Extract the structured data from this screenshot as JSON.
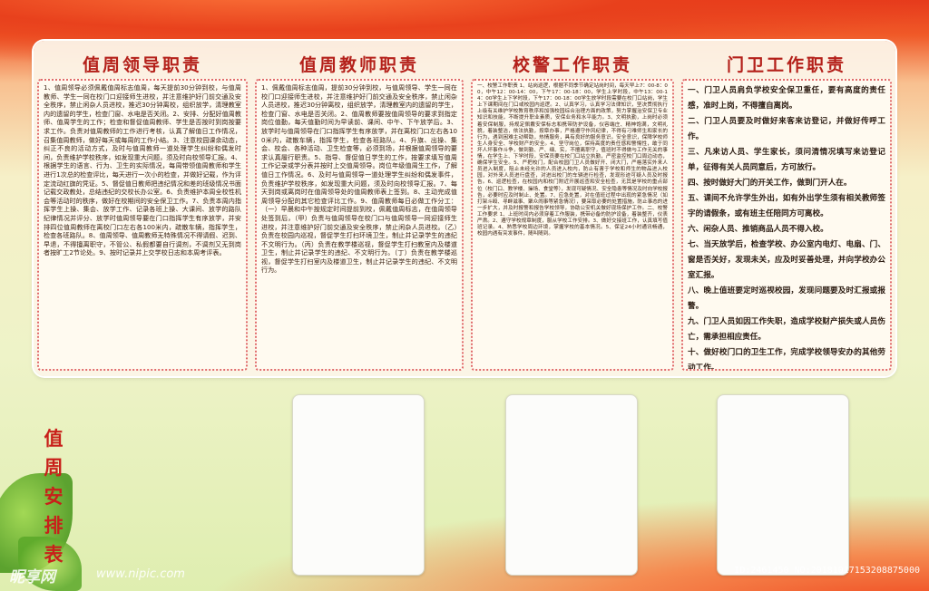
{
  "columns": [
    {
      "title": "值周领导职责",
      "text": "1、值周领导必须佩戴值周标志值周，每天提前30分钟到校，与值周教师、学生一同在校门口迎接师生进校，并注意维护好门前交通及安全秩序，禁止闲杂人员进校，推迟30分钟离校，组织放学，清理教室内的遗留的学生，检查门窗、水电是否关闭。2、安排、分配好值周教师、值周学生的工作；检查和督促值周教师、学生是否按时到岗按要求工作。负责对值周教师的工作进行考核，认真了解值日工作情况，召集值周教师，做好每天或每周的工作小结。3、注意校园课余动态，纠正不良的活动方式，及时与值周教师一道处理学生纠纷和偶发时间，负责维护学校秩序，如发现重大问题，须及时向校领导汇报。4、根据学生的语言、行为、卫生的实际情况，每周带领值周教师和学生进行1次总的检查评比，每天进行一次小的检查，并做好记载，作为评定流动红旗的凭证。5、督促值日教师把违纪情况和差的班级情况书面记载交政教处，总结违纪的交校长办公室。6、负责维护本周全校性机会等活动时的秩序，做好在校期间的安全保卫工作。7、负责本周内指挥学生上操、集会、放学工作、记录各班上操、大课间、放学的路队纪律情况并评分、放学时值周领导要在门口指挥学生有序放学，并安排四位值周教师在离校门口左右各100米内，疏散车辆，指挥学生，检查各班路队。8、值周领导、值周教师无特殊情况不得请假、迟到、早退，不得擅离职守，不管公、私假都要自行调剂，不调剂又无到岗者按旷工2节论处。9、按时记录并上交学校日志和本周考评表。"
    },
    {
      "title": "值周教师职责",
      "text": "1、佩戴值周标志值周，提前30分钟到校，与值周领导、学生一同在校门口迎接师生进校，并注意维护好门前交通及安全秩序，禁止闲杂人员进校，推迟30分钟离校，组织放学，清理教室内的遗留的学生，检查门窗、水电是否关闭。2、值周教师要按值周领导的要求到指定岗位值勤，每天值勤时间为早读前、课间、中午、下午放学后。3、放学时与值周领导在门口指挥学生有序放学，并在离校门口左右各100米内，疏散车辆，指挥学生，检查各班路队。4、升旗、出操、集会、校会、各种活动、卫生检查等，必须到场，并根据值周领导的要求认真履行职责。5、指导、督促值日学生的工作，按要求填写值周工作记录或学分表并按时上交值周领导。岗位年级值周生工作，了解值日工作情况。6、及时与值周领导一道处理学生纠纷和偶发事件，负责维护学校秩序，如发现重大问题，须及时向校领导汇报。7、每天到岗或离岗时在值周领导处的值周教师表上签到。8、主动完成值周领导分配的其它检查评比工作。9、值周教师每日必做工作分工：（一）早晨和中午按规定时间提前到校，佩戴值周标志，在值周领导处签到后，（甲）负责与值周领导在校门口与值周领导一同迎接师生进校，并注意维护好门前交通及安全秩序，禁止闲杂人员进校。（乙）负责在校园内巡视，督促学生打扫环境卫生，制止并记录学生的违纪不文明行为。（丙）负责在教学楼巡视，督促学生打扫教室内及楼道卫生，制止并记录学生的违纪、不文明行为。（丁）负责在教学楼巡视，督促学生打扫室内及楼道卫生，制止并记录学生的违纪、不文明行为。"
    },
    {
      "title": "校警工作职责",
      "text": "一、校警工作职责 1、站岗巡逻，根据不同季节确定站岗时间，每天早上7：00-8：00，中午12：00-14：00，下午17：00-18：00，学生上学时段，中午13：00-14：00学生上下学时段，下午17：00-18：00学生放学时段需要在校门口站岗，学生上下课期间在门口或校园内巡逻。2、认真学习，认真学习法律知识，坚决贯彻执行上级有关维护学校教育秩序和加强校园综合治理方面的政策，努力掌握治安保卫专业知识和技能，不断提升职业素质，安保业务和水平能力。3、文明执勤，上岗时必须着安保制服，持规定佩戴安保标志和携带防护设备，仪容端庄、精神饱满，文明礼貌，着装整洁，依法执勤，按章办事，严格遵守作风纪律，不得有刁难师生和家长的行为，遇到困难主动帮助，热情服务，具有良好的服务意识。安全意识，保障学校师生人身安全、学校财产的安全。4、坚守岗位，保持高度的责任感和警惕性，敢于同坏人坏事作斗争，做到勤、严、细、实，不擅离职守，值班时不得做与工作无关的事情，在学生上、下学时段，安保员要在校门口站立执勤，严密监控校门口周边动态，确保学生安全。5、严把校门，配合校园门卫人员做好开、闭大门，严格落实外来人员进入制度，阻止未经允许的人员进入校内，防止有害于学校和师生的物品进入校园，对外来人员进行盘查，对进出校门的车辆进行检查，发现形迹可疑人员及时报告。6、巡逻检查，在校园内和校门附近开展巡查和安全检查，无其是学校的重点部位（校门口、教学楼、操场、食堂等），发现可疑情况、安全隐患等情况及时向学校报告，必要时应及时制止、处置。7、应急处置，对在值班过程中出现的紧急情况（如打架斗殴、寻衅滋事、聚众闹事等紧急情况），要采取必要的处置措施，防止事态的进一步扩大，并及时报警和报告学校领导，协助公安机关做好现场保护工作。二、校警工作要求 1、上班时间内必须穿着工作服装，携带必备的防护设备，着装整齐，仪表严肃。2、遵守学校规章制度，服从学校工作安排。3、做好交接班工作，认真填写值班记录。4、熟悉学校周边环境，掌握学校的基本情况。5、保证24小时通讯畅通，校园内遇有突发事件，随叫随到。"
    },
    {
      "title": "门卫工作职责",
      "lines": [
        "一、门卫人员肩负学校安全保卫重任，要有高度的责任感，准时上岗，不得擅自离岗。",
        "二、门卫人员要及时做好来客来访登记，并做好传呼工作。",
        "三、凡来访人员、学生家长，须问清情况填写来访登记单，征得有关人员同意后，方可放行。",
        "四、按时做好大门的开关工作，做到门开人在。",
        "五、课间不允许学生外出，如有外出学生须有相关教师签字的请假条，或有班主任陪同方可离校。",
        "六、闲杂人员、推销商品人员不得入校。",
        "七、当天放学后，检查学校、办公室内电灯、电扇、门、窗是否关好，发现未关，应及时妥善处理，并向学校办公室汇报。",
        "八、晚上值班要定时巡视校园，发现问题要及时汇报或报警。",
        "九、门卫人员如因工作失职，造成学校财产损失或人员伤亡，需承担相应责任。",
        "十、做好校门口的卫生工作，完成学校领导安办的其他劳动工作。"
      ]
    }
  ],
  "side_title": [
    "值",
    "周",
    "安",
    "排",
    "表"
  ],
  "watermark": {
    "logo": "昵享网",
    "url": "www.nipic.com",
    "id": "ID:2461450 NO:20181017153208875000"
  },
  "colors": {
    "title": "#b4201a",
    "side_title": "#c8201a",
    "border": "#e06a6a"
  }
}
